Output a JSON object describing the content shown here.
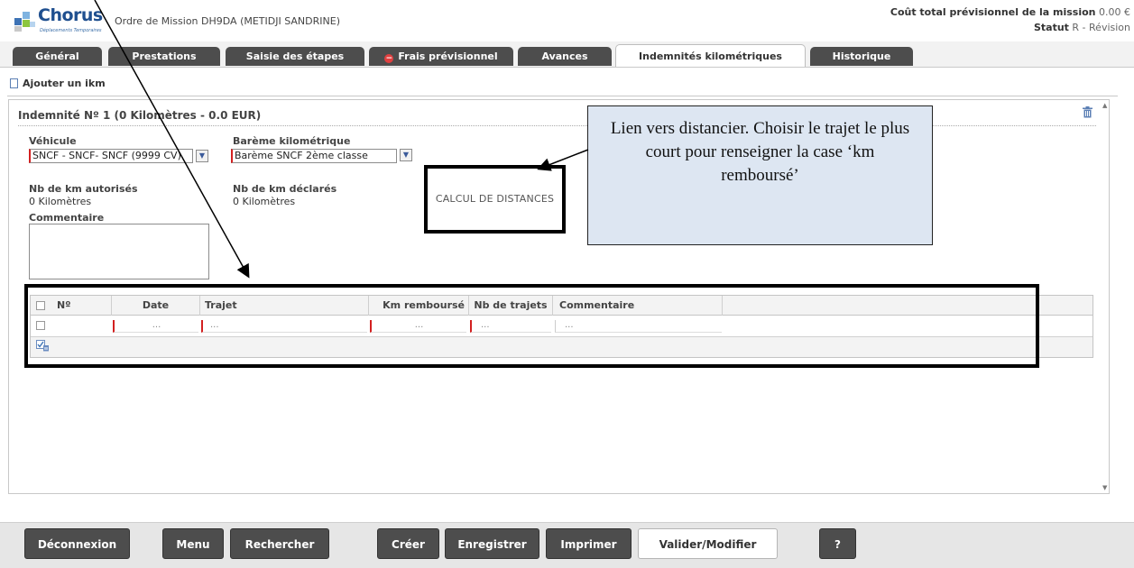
{
  "header": {
    "logo_text": "Chorus",
    "logo_sub": "Déplacements Temporaires",
    "mission_title": "Ordre de Mission DH9DA (METIDJI SANDRINE)",
    "cost_label": "Coût total prévisionnel de la mission",
    "cost_value": "0.00 €",
    "status_label": "Statut",
    "status_value": "R - Révision"
  },
  "tabs": [
    {
      "label": "Général"
    },
    {
      "label": "Prestations"
    },
    {
      "label": "Saisie des étapes"
    },
    {
      "label": "Frais prévisionnel",
      "icon": "warning-icon"
    },
    {
      "label": "Avances"
    },
    {
      "label": "Indemnités kilométriques",
      "active": true
    },
    {
      "label": "Historique"
    }
  ],
  "toolbar": {
    "add_label": "Ajouter un ikm"
  },
  "indemnite": {
    "title": "Indemnité Nº 1 (0 Kilomètres - 0.0 EUR)",
    "vehicule_label": "Véhicule",
    "vehicule_value": "SNCF - SNCF- SNCF (9999 CV)",
    "bareme_label": "Barème kilométrique",
    "bareme_value": "Barème SNCF 2ème classe",
    "km_autorises_label": "Nb de km autorisés",
    "km_autorises_value": "0 Kilomètres",
    "km_declares_label": "Nb de km déclarés",
    "km_declares_value": "0 Kilomètres",
    "commentaire_label": "Commentaire",
    "calcul_label": "CALCUL DE DISTANCES"
  },
  "grid": {
    "columns": [
      "Nº",
      "Date",
      "Trajet",
      "Km remboursé",
      "Nb de trajets",
      "Commentaire"
    ],
    "row_placeholders": [
      "...",
      "...",
      "...",
      "...",
      "..."
    ]
  },
  "annotation": {
    "callout_text": "Lien vers distancier. Choisir le trajet le plus court pour renseigner la case ‘km remboursé’"
  },
  "bottom_buttons": [
    {
      "label": "Déconnexion"
    },
    {
      "label": "Menu"
    },
    {
      "label": "Rechercher"
    },
    {
      "label": "Créer"
    },
    {
      "label": "Enregistrer"
    },
    {
      "label": "Imprimer"
    },
    {
      "label": "Valider/Modifier"
    },
    {
      "label": "?"
    }
  ]
}
